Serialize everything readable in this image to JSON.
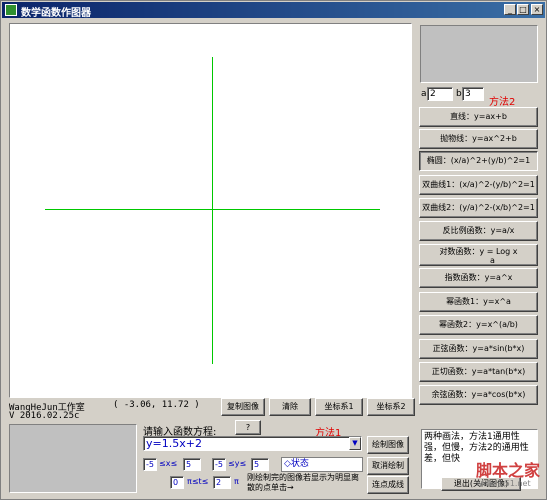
{
  "window": {
    "title": "数学函数作图器",
    "min": "_",
    "max": "□",
    "close": "×"
  },
  "params": {
    "a_label": "a",
    "a_value": "2",
    "b_label": "b",
    "b_value": "3",
    "method2": "方法2"
  },
  "func_buttons": [
    "直线：y=ax+b",
    "抛物线：y=ax^2+b",
    "椭圆：(x/a)^2+(y/b)^2=1",
    "双曲线1：(x/a)^2-(y/b)^2=1",
    "双曲线2：(y/a)^2-(x/b)^2=1",
    "反比例函数：y=a/x",
    "对数函数：y = Log  x",
    "指数函数：y=a^x",
    "幂函数1：y=x^a",
    "幂函数2：y=x^(a/b)",
    "正弦函数：y=a*sin(b*x)",
    "正切函数：y=a*tan(b*x)",
    "余弦函数：y=a*cos(b*x)"
  ],
  "log_base": "a",
  "studio": {
    "name": "WangHeJun工作室",
    "version": "V 2016.02.25c",
    "coords": "( -3.06, 11.72 )"
  },
  "toolbar": {
    "copy": "复制图像",
    "clear": "清除",
    "axes1": "坐标系1",
    "axes2": "坐标系2"
  },
  "input": {
    "prompt": "请输入函数方程:",
    "help": "?",
    "method1": "方法1",
    "equation": "y=1.5x+2",
    "xmin": "-5",
    "xlabel": "≤x≤",
    "xmax": "5",
    "ymin": "-5",
    "ylabel": "≤y≤",
    "ymax": "5",
    "tmin": "0",
    "tlabel": "π≤t≤",
    "tmax": "2",
    "tunit": "π",
    "status": "◇状态"
  },
  "actions": {
    "draw": "绘制图像",
    "cancel": "取消绘制",
    "connect": "连点成线"
  },
  "hint": "刚绘制完的图像若显示为明显离散的点单击→",
  "note": "两种画法，方法1通用性强，但慢，方法2的通用性差，但快",
  "exit": "退出(关闭图像)",
  "watermark": {
    "cn": "脚本之家",
    "url": "www.jb51.net"
  }
}
